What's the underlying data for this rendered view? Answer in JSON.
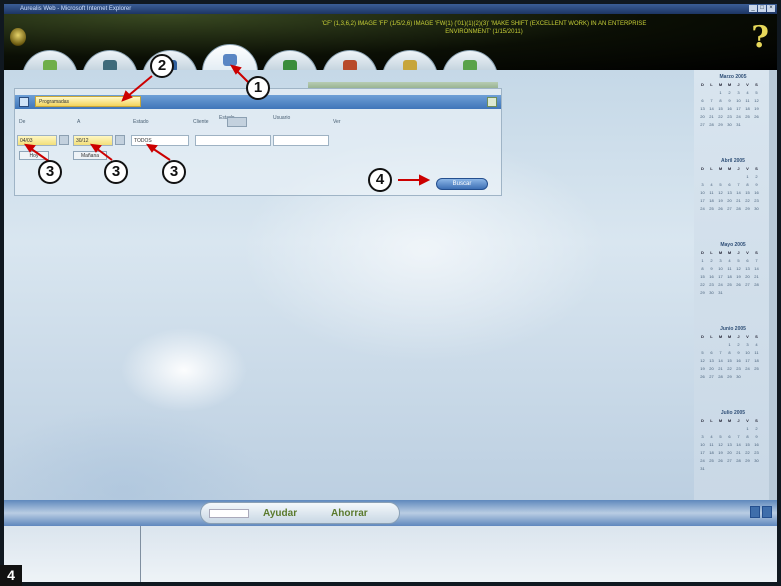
{
  "window": {
    "title": "Aurealis Web - Microsoft Internet Explorer"
  },
  "header": {
    "ticker": "'CF' (1,3,6,2) IMAGE 'FF' (1/5/2,6) IMAGE 'FW(1) ('01)(1)(2)(3)' 'MAKE SHIFT (EXCELLENT WORK) IN AN ENTERPRISE ENVIRONMENT' (1/15/2011)"
  },
  "tabs": [
    {
      "name": "home",
      "color": "#6fae4a"
    },
    {
      "name": "documents",
      "color": "#3f6a7a"
    },
    {
      "name": "search",
      "color": "#2f5f9e"
    },
    {
      "name": "network",
      "color": "#5a86c4"
    },
    {
      "name": "planet",
      "color": "#3b8d3b"
    },
    {
      "name": "people",
      "color": "#b84a2a"
    },
    {
      "name": "gifts",
      "color": "#c7a53b"
    },
    {
      "name": "charts",
      "color": "#5aa24a"
    }
  ],
  "panel": {
    "selector": "Programadas",
    "labels": [
      "De",
      "A",
      "Estado",
      "Cliente",
      "Estado",
      "Usuario",
      "Ver"
    ],
    "date_from": "04/03",
    "date_to": "30/12",
    "state_value": "TODOS",
    "buttons": [
      "Hoy",
      "Mañana"
    ],
    "search_button": "Buscar"
  },
  "calendars": [
    {
      "title": "Marzo 2005",
      "days": [
        "D",
        "L",
        "M",
        "M",
        "J",
        "V",
        "S"
      ],
      "dates": [
        "",
        "",
        "1",
        "2",
        "3",
        "4",
        "5",
        "6",
        "7",
        "8",
        "9",
        "10",
        "11",
        "12",
        "13",
        "14",
        "15",
        "16",
        "17",
        "18",
        "19",
        "20",
        "21",
        "22",
        "23",
        "24",
        "25",
        "26",
        "27",
        "28",
        "29",
        "30",
        "31"
      ]
    },
    {
      "title": "Abril 2005",
      "days": [
        "D",
        "L",
        "M",
        "M",
        "J",
        "V",
        "S"
      ],
      "dates": [
        "",
        "",
        "",
        "",
        "",
        "1",
        "2",
        "3",
        "4",
        "5",
        "6",
        "7",
        "8",
        "9",
        "10",
        "11",
        "12",
        "13",
        "14",
        "15",
        "16",
        "17",
        "18",
        "19",
        "20",
        "21",
        "22",
        "23",
        "24",
        "25",
        "26",
        "27",
        "28",
        "29",
        "30"
      ]
    },
    {
      "title": "Mayo 2005",
      "days": [
        "D",
        "L",
        "M",
        "M",
        "J",
        "V",
        "S"
      ],
      "dates": [
        "1",
        "2",
        "3",
        "4",
        "5",
        "6",
        "7",
        "8",
        "9",
        "10",
        "11",
        "12",
        "13",
        "14",
        "15",
        "16",
        "17",
        "18",
        "19",
        "20",
        "21",
        "22",
        "23",
        "24",
        "25",
        "26",
        "27",
        "28",
        "29",
        "30",
        "31"
      ]
    },
    {
      "title": "Junio 2005",
      "days": [
        "D",
        "L",
        "M",
        "M",
        "J",
        "V",
        "S"
      ],
      "dates": [
        "",
        "",
        "",
        "1",
        "2",
        "3",
        "4",
        "5",
        "6",
        "7",
        "8",
        "9",
        "10",
        "11",
        "12",
        "13",
        "14",
        "15",
        "16",
        "17",
        "18",
        "19",
        "20",
        "21",
        "22",
        "23",
        "24",
        "25",
        "26",
        "27",
        "28",
        "29",
        "30"
      ]
    },
    {
      "title": "Julio 2005",
      "days": [
        "D",
        "L",
        "M",
        "M",
        "J",
        "V",
        "S"
      ],
      "dates": [
        "",
        "",
        "",
        "",
        "",
        "1",
        "2",
        "3",
        "4",
        "5",
        "6",
        "7",
        "8",
        "9",
        "10",
        "11",
        "12",
        "13",
        "14",
        "15",
        "16",
        "17",
        "18",
        "19",
        "20",
        "21",
        "22",
        "23",
        "24",
        "25",
        "26",
        "27",
        "28",
        "29",
        "30",
        "31"
      ]
    }
  ],
  "bottom_nav": {
    "left_label": "Ayudar",
    "right_label": "Ahorrar"
  },
  "callouts": [
    "1",
    "2",
    "3",
    "3",
    "3",
    "4"
  ],
  "figure_number": "4"
}
